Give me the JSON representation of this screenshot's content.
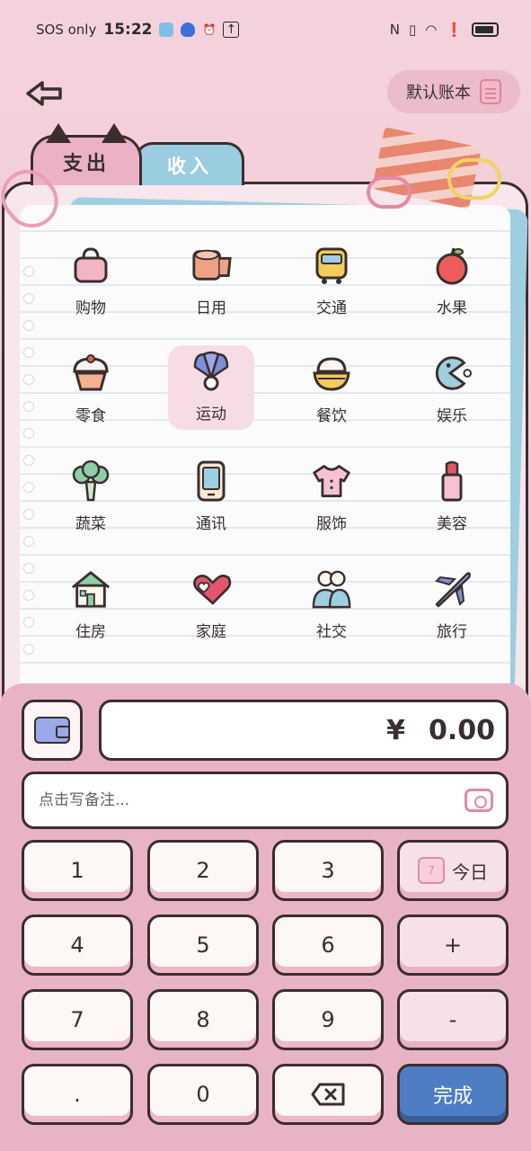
{
  "status_bar": {
    "carrier": "SOS only",
    "time": "15:22"
  },
  "header": {
    "book_label": "默认账本"
  },
  "tabs": [
    {
      "label": "支出",
      "active": true
    },
    {
      "label": "收入",
      "active": false
    }
  ],
  "categories": [
    {
      "label": "购物",
      "icon": "shopping-bag-icon"
    },
    {
      "label": "日用",
      "icon": "tissue-roll-icon"
    },
    {
      "label": "交通",
      "icon": "bus-icon"
    },
    {
      "label": "水果",
      "icon": "apple-icon"
    },
    {
      "label": "零食",
      "icon": "cupcake-icon"
    },
    {
      "label": "运动",
      "icon": "shuttlecock-icon",
      "selected": true
    },
    {
      "label": "餐饮",
      "icon": "rice-bowl-icon"
    },
    {
      "label": "娱乐",
      "icon": "pacman-icon"
    },
    {
      "label": "蔬菜",
      "icon": "broccoli-icon"
    },
    {
      "label": "通讯",
      "icon": "phone-icon"
    },
    {
      "label": "服饰",
      "icon": "shirt-icon"
    },
    {
      "label": "美容",
      "icon": "lipstick-icon"
    },
    {
      "label": "住房",
      "icon": "house-icon"
    },
    {
      "label": "家庭",
      "icon": "hearts-icon"
    },
    {
      "label": "社交",
      "icon": "people-icon"
    },
    {
      "label": "旅行",
      "icon": "airplane-icon"
    }
  ],
  "amount": {
    "currency": "¥",
    "value": "0.00"
  },
  "remark": {
    "placeholder": "点击写备注..."
  },
  "keypad": {
    "k1": "1",
    "k2": "2",
    "k3": "3",
    "k4": "4",
    "k5": "5",
    "k6": "6",
    "k7": "7",
    "k8": "8",
    "k9": "9",
    "kdot": ".",
    "k0": "0",
    "today": "今日",
    "today_day": "7",
    "plus": "+",
    "minus": "-",
    "done": "完成"
  },
  "colors": {
    "accent_pink": "#e8b3c5",
    "tab_blue": "#9bcde0",
    "done_blue": "#4f7dc3"
  }
}
